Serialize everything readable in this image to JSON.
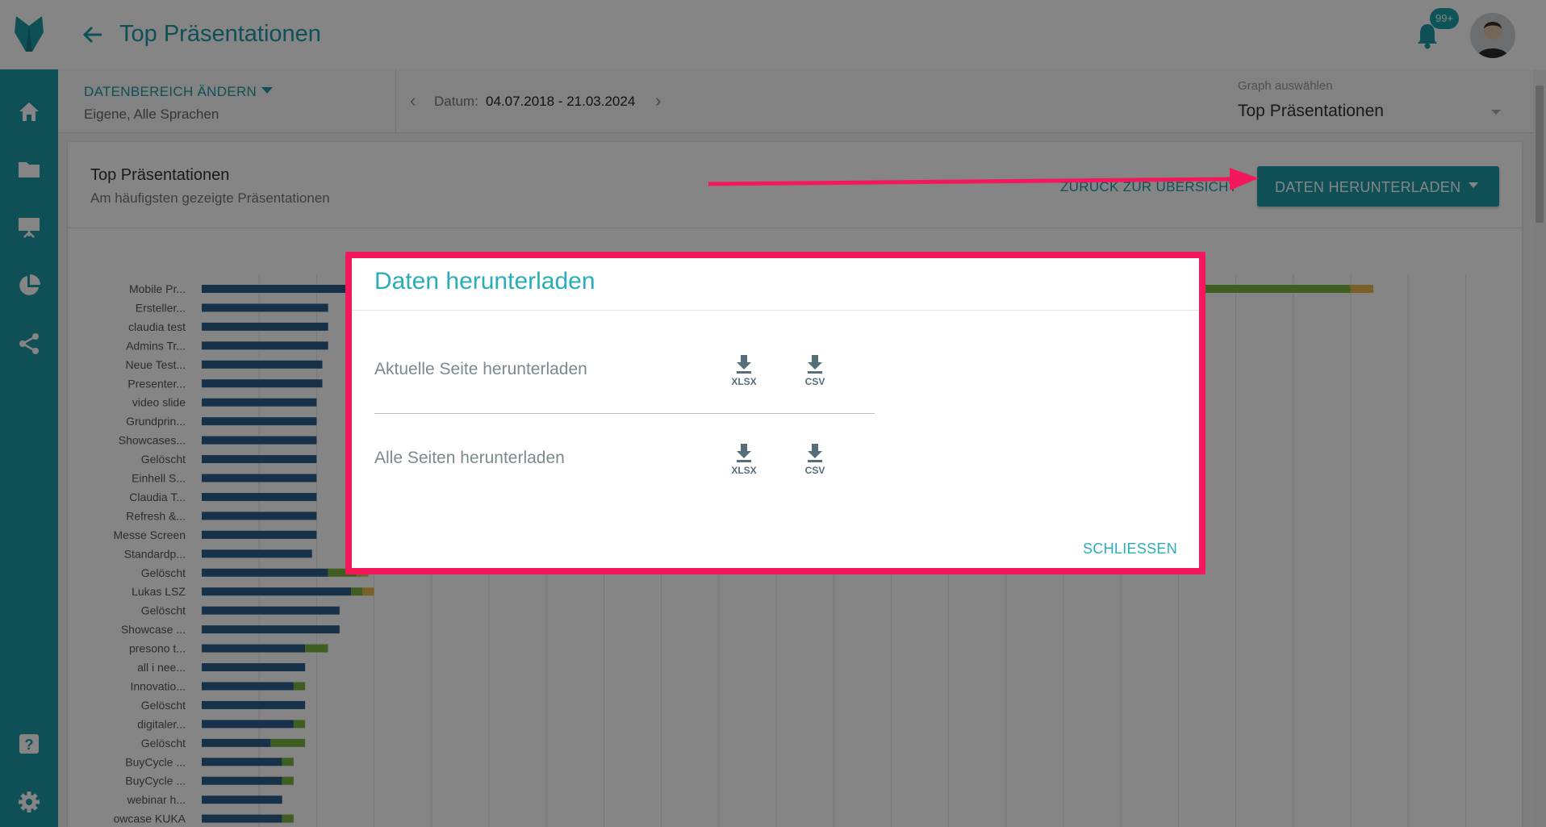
{
  "header": {
    "title": "Top Präsentationen",
    "notification_badge": "99+"
  },
  "filters": {
    "range_label": "DATENBEREICH ÄNDERN",
    "range_sub": "Eigene, Alle Sprachen",
    "date_label": "Datum:",
    "date_value": "04.07.2018 - 21.03.2024",
    "graph_label": "Graph auswählen",
    "graph_value": "Top Präsentationen"
  },
  "card": {
    "title": "Top Präsentationen",
    "subtitle": "Am häufigsten gezeigte Präsentationen",
    "back_label": "ZURÜCK ZUR ÜBERSICHT",
    "download_label": "DATEN HERUNTERLADEN"
  },
  "dialog": {
    "title": "Daten herunterladen",
    "row1_label": "Aktuelle Seite herunterladen",
    "row2_label": "Alle Seiten herunterladen",
    "xlsx": "XLSX",
    "csv": "CSV",
    "close_label": "SCHLIESSEN"
  },
  "colors": {
    "accent": "#1d9aa6",
    "series_blue": "#2c5f8a",
    "series_green": "#7cb342",
    "series_yellow": "#e8b84a",
    "highlight": "#f4175c"
  },
  "chart_data": {
    "type": "bar",
    "orientation": "horizontal",
    "stacked": true,
    "categories": [
      "Mobile Pr...",
      "Ersteller...",
      "claudia test",
      "Admins Tr...",
      "Neue Test...",
      "Presenter...",
      "video slide",
      "Grundprin...",
      "Showcases...",
      "Gelöscht",
      "Einhell S...",
      "Claudia T...",
      "Refresh &...",
      "Messe Screen",
      "Standardp...",
      "Gelöscht",
      "Lukas LSZ",
      "Gelöscht",
      "Showcase ...",
      "presono t...",
      "all i nee...",
      "Innovatio...",
      "Gelöscht",
      "digitaler...",
      "Gelöscht",
      "BuyCycle ...",
      "BuyCycle ...",
      "webinar h...",
      "owcase KUKA"
    ],
    "series": [
      {
        "values": [
          140,
          110,
          110,
          110,
          105,
          105,
          100,
          100,
          100,
          100,
          100,
          100,
          100,
          100,
          96,
          110,
          130,
          120,
          120,
          90,
          90,
          80,
          90,
          80,
          60,
          70,
          70,
          70,
          70
        ]
      },
      {
        "values": [
          860,
          0,
          0,
          0,
          0,
          0,
          0,
          0,
          0,
          0,
          0,
          0,
          0,
          0,
          0,
          25,
          10,
          0,
          0,
          20,
          0,
          10,
          0,
          10,
          30,
          10,
          10,
          0,
          10
        ]
      },
      {
        "values": [
          20,
          0,
          0,
          0,
          0,
          0,
          0,
          0,
          0,
          0,
          0,
          0,
          0,
          0,
          0,
          10,
          10,
          0,
          0,
          0,
          0,
          0,
          0,
          0,
          0,
          0,
          0,
          0,
          0
        ]
      }
    ],
    "xlim": [
      0,
      1100
    ],
    "grid": true
  }
}
